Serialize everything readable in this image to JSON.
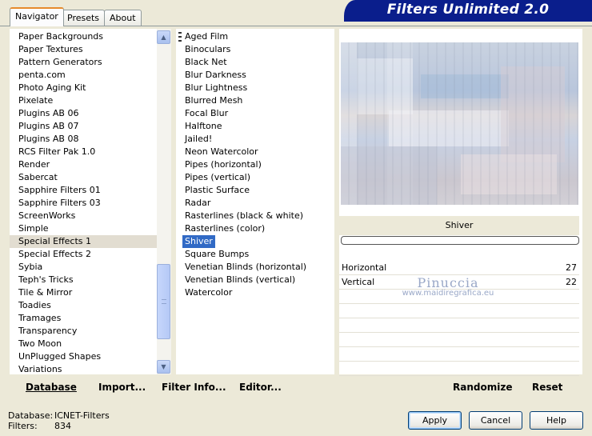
{
  "tabs": [
    "Navigator",
    "Presets",
    "About"
  ],
  "banner": "Filters Unlimited 2.0",
  "categories": [
    "Paper Backgrounds",
    "Paper Textures",
    "Pattern Generators",
    "penta.com",
    "Photo Aging Kit",
    "Pixelate",
    "Plugins AB 06",
    "Plugins AB 07",
    "Plugins AB 08",
    "RCS Filter Pak 1.0",
    "Render",
    "Sabercat",
    "Sapphire Filters 01",
    "Sapphire Filters 03",
    "ScreenWorks",
    "Simple",
    "Special Effects 1",
    "Special Effects 2",
    "Sybia",
    "Teph's Tricks",
    "Tile & Mirror",
    "Toadies",
    "Tramages",
    "Transparency",
    "Two Moon",
    "UnPlugged Shapes",
    "Variations"
  ],
  "selected_category": "Special Effects 1",
  "filters": [
    "Aged Film",
    "Binoculars",
    "Black Net",
    "Blur Darkness",
    "Blur Lightness",
    "Blurred Mesh",
    "Focal Blur",
    "Halftone",
    "Jailed!",
    "Neon Watercolor",
    "Pipes (horizontal)",
    "Pipes (vertical)",
    "Plastic Surface",
    "Radar",
    "Rasterlines (black & white)",
    "Rasterlines (color)",
    "Shiver",
    "Square Bumps",
    "Venetian Blinds (horizontal)",
    "Venetian Blinds (vertical)",
    "Watercolor"
  ],
  "selected_filter": "Shiver",
  "filter_title": "Shiver",
  "params": [
    {
      "label": "Horizontal",
      "value": "27"
    },
    {
      "label": "Vertical",
      "value": "22"
    }
  ],
  "watermark": {
    "name": "Pinuccia",
    "url": "www.maidiregrafica.eu"
  },
  "links": {
    "database": "Database",
    "import": "Import...",
    "filter_info": "Filter Info...",
    "editor": "Editor...",
    "randomize": "Randomize",
    "reset": "Reset"
  },
  "status": {
    "database_label": "Database:",
    "database_value": "ICNET-Filters",
    "filters_label": "Filters:",
    "filters_value": "834"
  },
  "buttons": {
    "apply": "Apply",
    "cancel": "Cancel",
    "help": "Help"
  },
  "colors": {
    "banner": "#0a1e8c",
    "selection": "#316ac5",
    "tab_accent": "#e68b2c"
  }
}
